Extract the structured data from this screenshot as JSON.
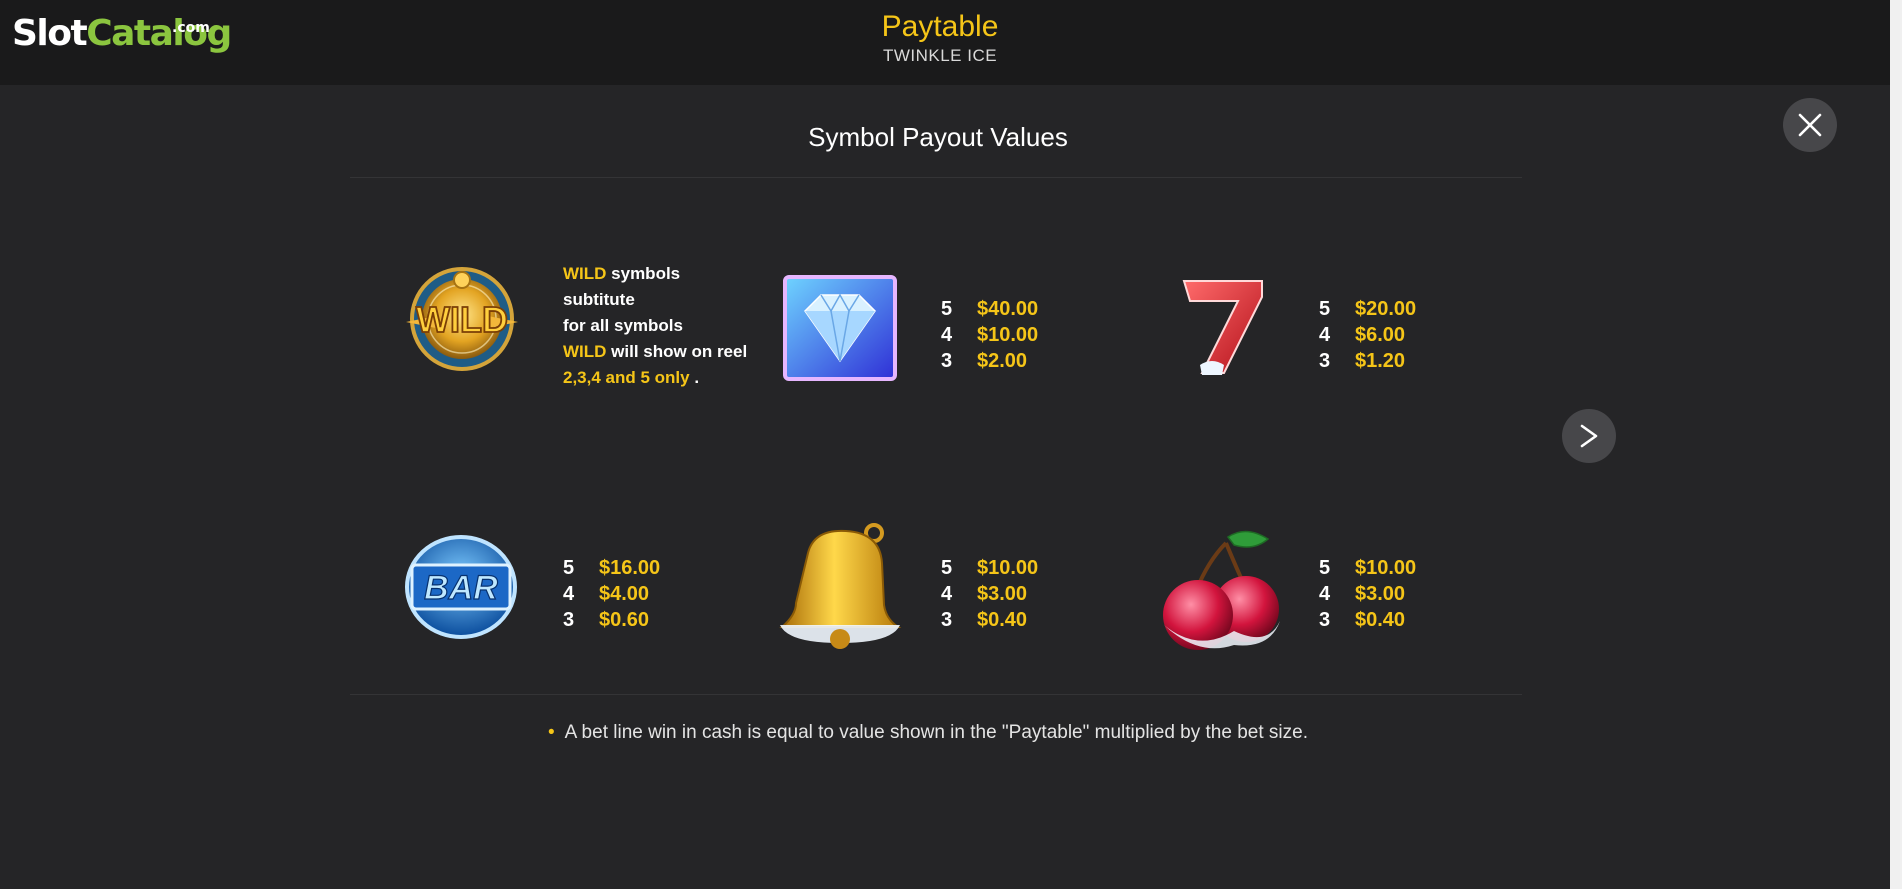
{
  "header": {
    "logo_slot": "Slot",
    "logo_catalog": "Catalog",
    "logo_dotcom": ".com",
    "title": "Paytable",
    "subtitle": "TWINKLE ICE"
  },
  "main": {
    "section_title": "Symbol Payout Values",
    "wild": {
      "word1": "WILD",
      "rest1": " symbols",
      "line2": "subtitute",
      "line3": "for all symbols",
      "word2": "WILD",
      "rest2": " will show on reel",
      "reels": "2,3,4 and 5 only",
      "end": " ."
    },
    "symbols": [
      {
        "icon": "diamond-icon",
        "pays": [
          {
            "count": "5",
            "value": "$40.00"
          },
          {
            "count": "4",
            "value": "$10.00"
          },
          {
            "count": "3",
            "value": "$2.00"
          }
        ]
      },
      {
        "icon": "seven-icon",
        "pays": [
          {
            "count": "5",
            "value": "$20.00"
          },
          {
            "count": "4",
            "value": "$6.00"
          },
          {
            "count": "3",
            "value": "$1.20"
          }
        ]
      },
      {
        "icon": "bar-icon",
        "pays": [
          {
            "count": "5",
            "value": "$16.00"
          },
          {
            "count": "4",
            "value": "$4.00"
          },
          {
            "count": "3",
            "value": "$0.60"
          }
        ]
      },
      {
        "icon": "bell-icon",
        "pays": [
          {
            "count": "5",
            "value": "$10.00"
          },
          {
            "count": "4",
            "value": "$3.00"
          },
          {
            "count": "3",
            "value": "$0.40"
          }
        ]
      },
      {
        "icon": "cherry-icon",
        "pays": [
          {
            "count": "5",
            "value": "$10.00"
          },
          {
            "count": "4",
            "value": "$3.00"
          },
          {
            "count": "3",
            "value": "$0.40"
          }
        ]
      }
    ],
    "footnote": "A bet line win in cash is equal to value shown in the \"Paytable\" multiplied by the bet size.",
    "bullet": "•",
    "wild_symbol_label": "WILD",
    "bar_symbol_label": "BAR"
  },
  "colors": {
    "accent": "#f5c518",
    "logo_green": "#8bc53f",
    "background": "#252527",
    "header_bg": "#1a1a1b",
    "button_bg": "#47474a"
  }
}
